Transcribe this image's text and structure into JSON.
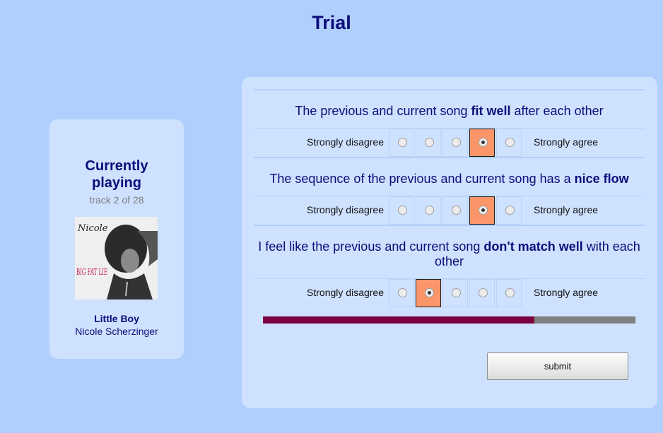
{
  "page": {
    "title": "Trial"
  },
  "now_playing": {
    "heading_line1": "Currently",
    "heading_line2": "playing",
    "track_info": "track 2 of 28",
    "song_title": "Little Boy",
    "artist": "Nicole Scherzinger",
    "album_art_text": {
      "top": "Nicole",
      "bottom": "BIG FAT LIE"
    }
  },
  "survey": {
    "scale_left_label": "Strongly disagree",
    "scale_right_label": "Strongly agree",
    "scale_points": 5,
    "questions": [
      {
        "text_before": "The previous and current song ",
        "text_bold": "fit well",
        "text_after": " after each other",
        "selected": 4
      },
      {
        "text_before": "The sequence of the previous and current song has a ",
        "text_bold": "nice flow",
        "text_after": "",
        "selected": 4
      },
      {
        "text_before": "I feel like the previous and current song ",
        "text_bold": "don't match well",
        "text_after": " with each other",
        "selected": 2
      }
    ],
    "progress": 0.729,
    "submit_label": "submit"
  },
  "colors": {
    "background": "#b1cffd",
    "panel": "#cee1ff",
    "title_text": "#0c0c7a",
    "selected_cell": "#fc966a",
    "progress_fill": "#7c003f",
    "progress_track": "#808080"
  }
}
